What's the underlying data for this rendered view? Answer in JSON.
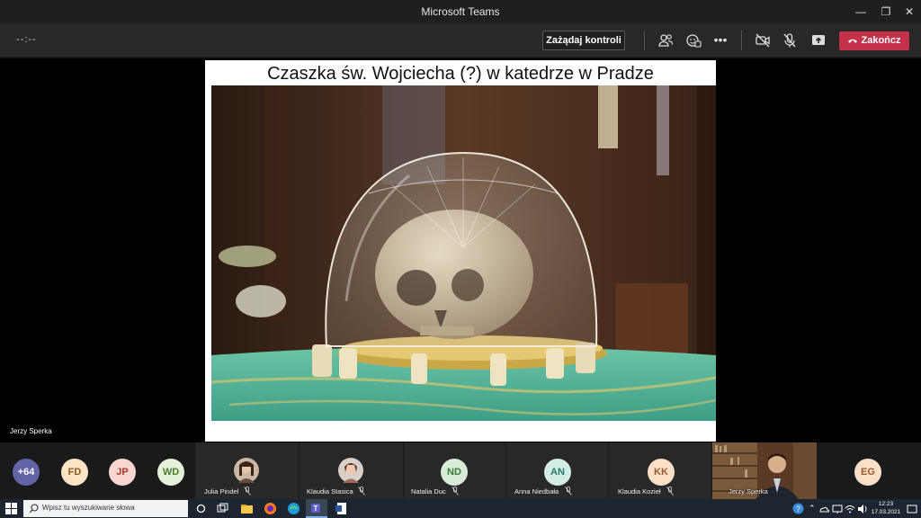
{
  "window": {
    "title": "Microsoft Teams"
  },
  "meeting": {
    "timer": "--:--",
    "request_control_label": "Zażądaj kontroli",
    "end_label": "Zakończ"
  },
  "slide": {
    "title": "Czaszka św. Wojciecha (?) w katedrze w Pradze"
  },
  "presenter": {
    "name": "Jerzy Sperka"
  },
  "participants": {
    "overflow": "+64",
    "tiles": [
      {
        "initials": "FD",
        "color": "#fbe5c4"
      },
      {
        "initials": "JP",
        "color": "#fbd5d0"
      },
      {
        "initials": "WD",
        "color": "#e3f2d9"
      },
      {
        "name": "Julia Pindel"
      },
      {
        "name": "Klaudia Stasica"
      },
      {
        "name": "Natalia Duc",
        "initials": "ND",
        "color": "#d8ecd8"
      },
      {
        "name": "Anna Niedbała",
        "initials": "AN",
        "color": "#d2ece6"
      },
      {
        "name": "Klaudia Kozieł",
        "initials": "KK",
        "color": "#fbe0c8"
      },
      {
        "name": "Jerzy Sperka"
      },
      {
        "initials": "EG",
        "color": "#fbe0c8"
      }
    ]
  },
  "taskbar": {
    "search_placeholder": "Wpisz tu wyszukiwane słowa",
    "time": "12:23",
    "date": "17.03.2021"
  },
  "colors": {
    "end_button": "#c4314b",
    "overflow_avatar": "#6264a7",
    "toolbar": "#292828"
  }
}
